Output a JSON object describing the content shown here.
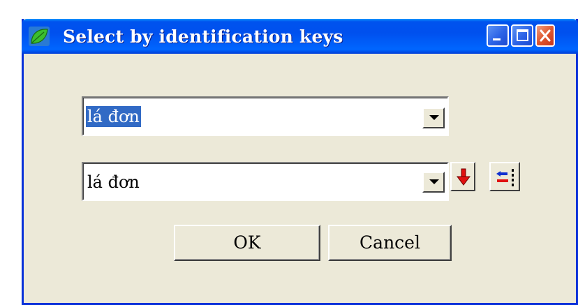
{
  "window": {
    "title": "Select by identification keys",
    "app_icon": "leaf-icon",
    "controls": {
      "minimize_icon": "minimize-icon",
      "maximize_icon": "maximize-icon",
      "close_icon": "close-icon"
    }
  },
  "fields": {
    "key_combo_1": {
      "value": "lá đơn",
      "selected": true,
      "dropdown_icon": "chevron-down-icon"
    },
    "key_combo_2": {
      "value": "lá đơn",
      "dropdown_icon": "chevron-down-icon"
    }
  },
  "tools": {
    "move_down_icon": "arrow-down-icon",
    "swap_icon": "swap-arrows-icon"
  },
  "buttons": {
    "ok_label": "OK",
    "cancel_label": "Cancel"
  },
  "colors": {
    "title_bar": "#0053ee",
    "window_face": "#ece9d8",
    "selection": "#316ac5",
    "close_button": "#e0582f",
    "arrow_red": "#e01010",
    "arrow_blue": "#1030d0"
  }
}
